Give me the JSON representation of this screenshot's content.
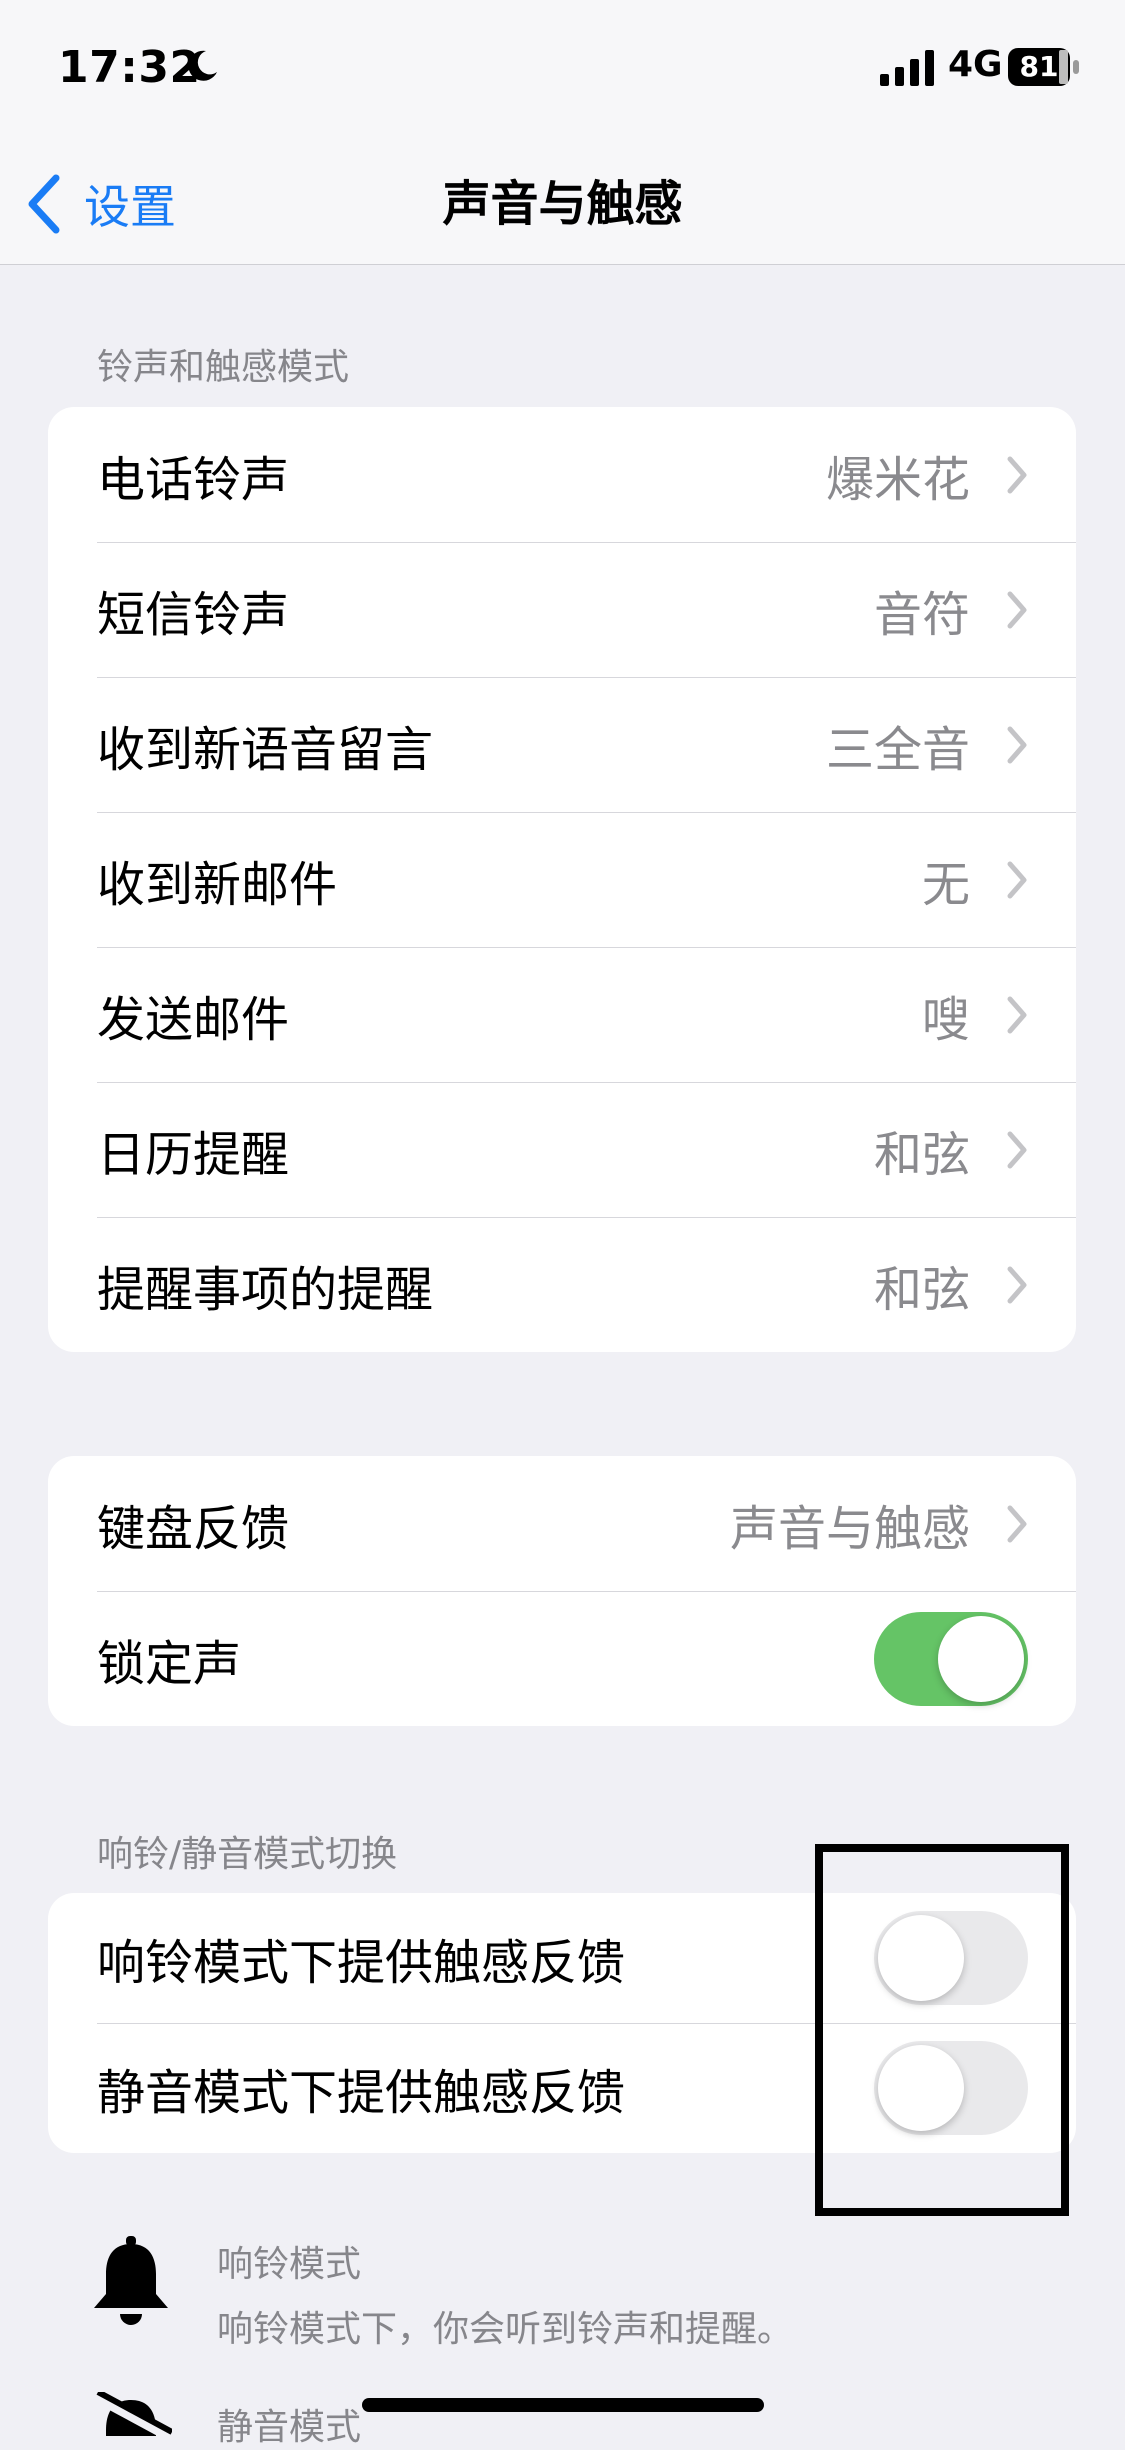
{
  "status_bar": {
    "time": "17:32",
    "network": "4G",
    "battery": "81"
  },
  "nav": {
    "back_label": "设置",
    "title": "声音与触感"
  },
  "ringtones": {
    "header": "铃声和触感模式",
    "rows": [
      {
        "label": "电话铃声",
        "value": "爆米花"
      },
      {
        "label": "短信铃声",
        "value": "音符"
      },
      {
        "label": "收到新语音留言",
        "value": "三全音"
      },
      {
        "label": "收到新邮件",
        "value": "无"
      },
      {
        "label": "发送邮件",
        "value": "嗖"
      },
      {
        "label": "日历提醒",
        "value": "和弦"
      },
      {
        "label": "提醒事项的提醒",
        "value": "和弦"
      }
    ]
  },
  "keyboard": {
    "feedback_label": "键盘反馈",
    "feedback_value": "声音与触感",
    "lock_sound_label": "锁定声",
    "lock_sound_on": true
  },
  "switch_section": {
    "header": "响铃/静音模式切换",
    "ring_haptics_label": "响铃模式下提供触感反馈",
    "ring_haptics_on": false,
    "silent_haptics_label": "静音模式下提供触感反馈",
    "silent_haptics_on": false
  },
  "modes": {
    "ring_title": "响铃模式",
    "ring_desc": "响铃模式下，你会听到铃声和提醒。",
    "silent_title": "静音模式"
  },
  "colors": {
    "accent": "#1a7cf5",
    "toggle_on": "#65c466",
    "toggle_off": "#e9e9eb"
  }
}
